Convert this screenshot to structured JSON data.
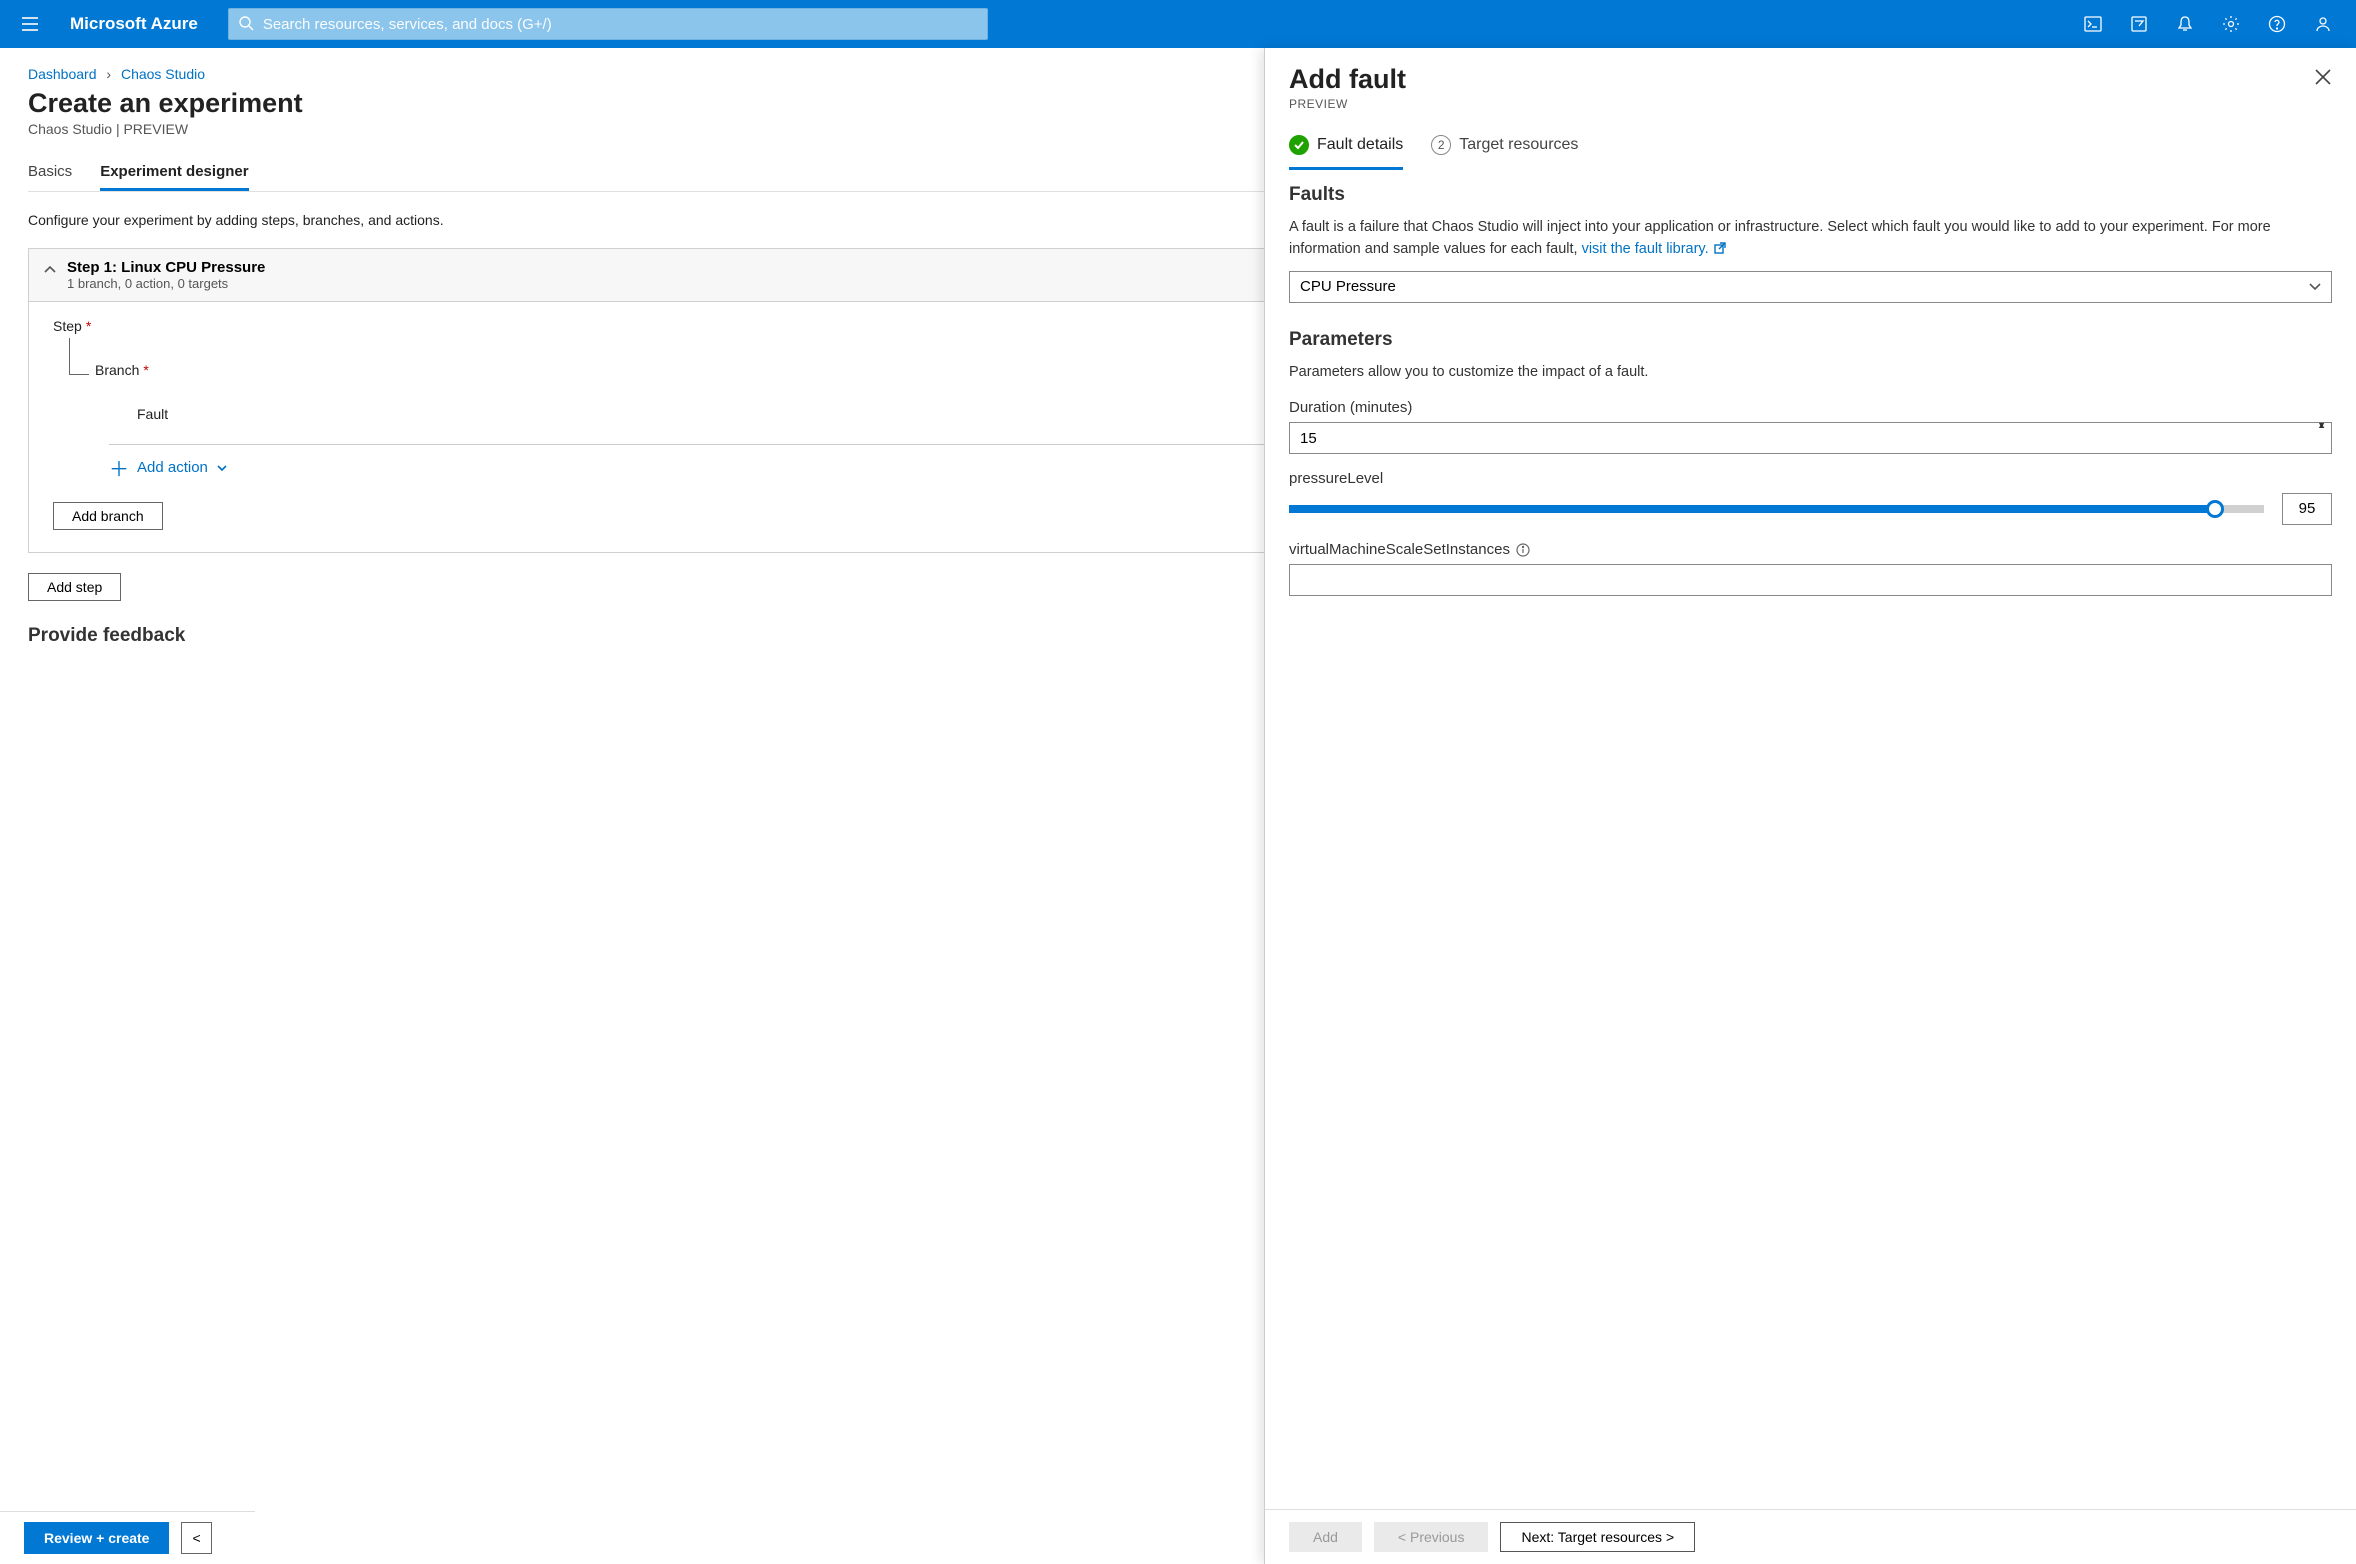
{
  "topbar": {
    "brand": "Microsoft Azure",
    "search_placeholder": "Search resources, services, and docs (G+/)"
  },
  "breadcrumb": {
    "items": [
      "Dashboard",
      "Chaos Studio"
    ]
  },
  "page": {
    "title": "Create an experiment",
    "subtitle": "Chaos Studio | PREVIEW",
    "tabs": {
      "basics": "Basics",
      "designer": "Experiment designer"
    },
    "description": "Configure your experiment by adding steps, branches, and actions.",
    "step": {
      "title": "Step 1: Linux CPU Pressure",
      "sub": "1 branch, 0 action, 0 targets"
    },
    "tree": {
      "step": "Step",
      "branch": "Branch",
      "fault": "Fault"
    },
    "add_action": "Add action",
    "add_branch": "Add branch",
    "add_step": "Add step",
    "feedback_heading": "Provide feedback",
    "footer": {
      "review": "Review + create",
      "prev": "<"
    }
  },
  "flyout": {
    "title": "Add fault",
    "sub": "PREVIEW",
    "tabs": {
      "details": "Fault details",
      "targets": "Target resources",
      "step2": "2"
    },
    "faults": {
      "heading": "Faults",
      "desc": "A fault is a failure that Chaos Studio will inject into your application or infrastructure. Select which fault you would like to add to your experiment. For more information and sample values for each fault, ",
      "link": "visit the fault library.",
      "selected": "CPU Pressure"
    },
    "params": {
      "heading": "Parameters",
      "desc": "Parameters allow you to customize the impact of a fault.",
      "duration_label": "Duration (minutes)",
      "duration_value": "15",
      "pressure_label": "pressureLevel",
      "pressure_value": "95",
      "vmss_label": "virtualMachineScaleSetInstances",
      "vmss_value": ""
    },
    "footer": {
      "add": "Add",
      "prev": "< Previous",
      "next": "Next: Target resources >"
    }
  }
}
